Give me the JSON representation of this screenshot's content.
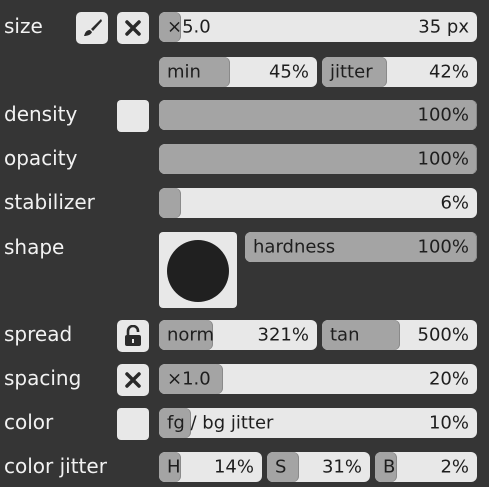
{
  "size": {
    "label": "size",
    "slider_label": "×5.0",
    "value": "35 px",
    "fill": 0.04
  },
  "size_sub": {
    "min": {
      "label": "min",
      "value": "45%",
      "fill": 0.45
    },
    "jitter": {
      "label": "jitter",
      "value": "42%",
      "fill": 0.42
    }
  },
  "density": {
    "label": "density",
    "value": "100%",
    "fill": 1.0
  },
  "opacity": {
    "label": "opacity",
    "value": "100%",
    "fill": 1.0
  },
  "stabilizer": {
    "label": "stabilizer",
    "value": "6%",
    "fill": 0.06
  },
  "shape": {
    "label": "shape",
    "hardness_label": "hardness",
    "hardness_value": "100%",
    "fill": 1.0
  },
  "spread": {
    "label": "spread",
    "norm": {
      "label": "norm",
      "value": "321%",
      "fill": 0.34
    },
    "tan": {
      "label": "tan",
      "value": "500%",
      "fill": 0.5
    }
  },
  "spacing": {
    "label": "spacing",
    "slider_label": "×1.0",
    "value": "20%",
    "fill": 0.2
  },
  "color": {
    "label": "color",
    "fg_label": "fg",
    "rest_label": " / bg jitter",
    "value": "10%",
    "fill": 0.1
  },
  "color_jitter": {
    "label": "color jitter",
    "h": {
      "label": "H",
      "value": "14%",
      "fill": 0.14
    },
    "s": {
      "label": "S",
      "value": "31%",
      "fill": 0.31
    },
    "b": {
      "label": "B",
      "value": "2%",
      "fill": 0.02
    }
  }
}
